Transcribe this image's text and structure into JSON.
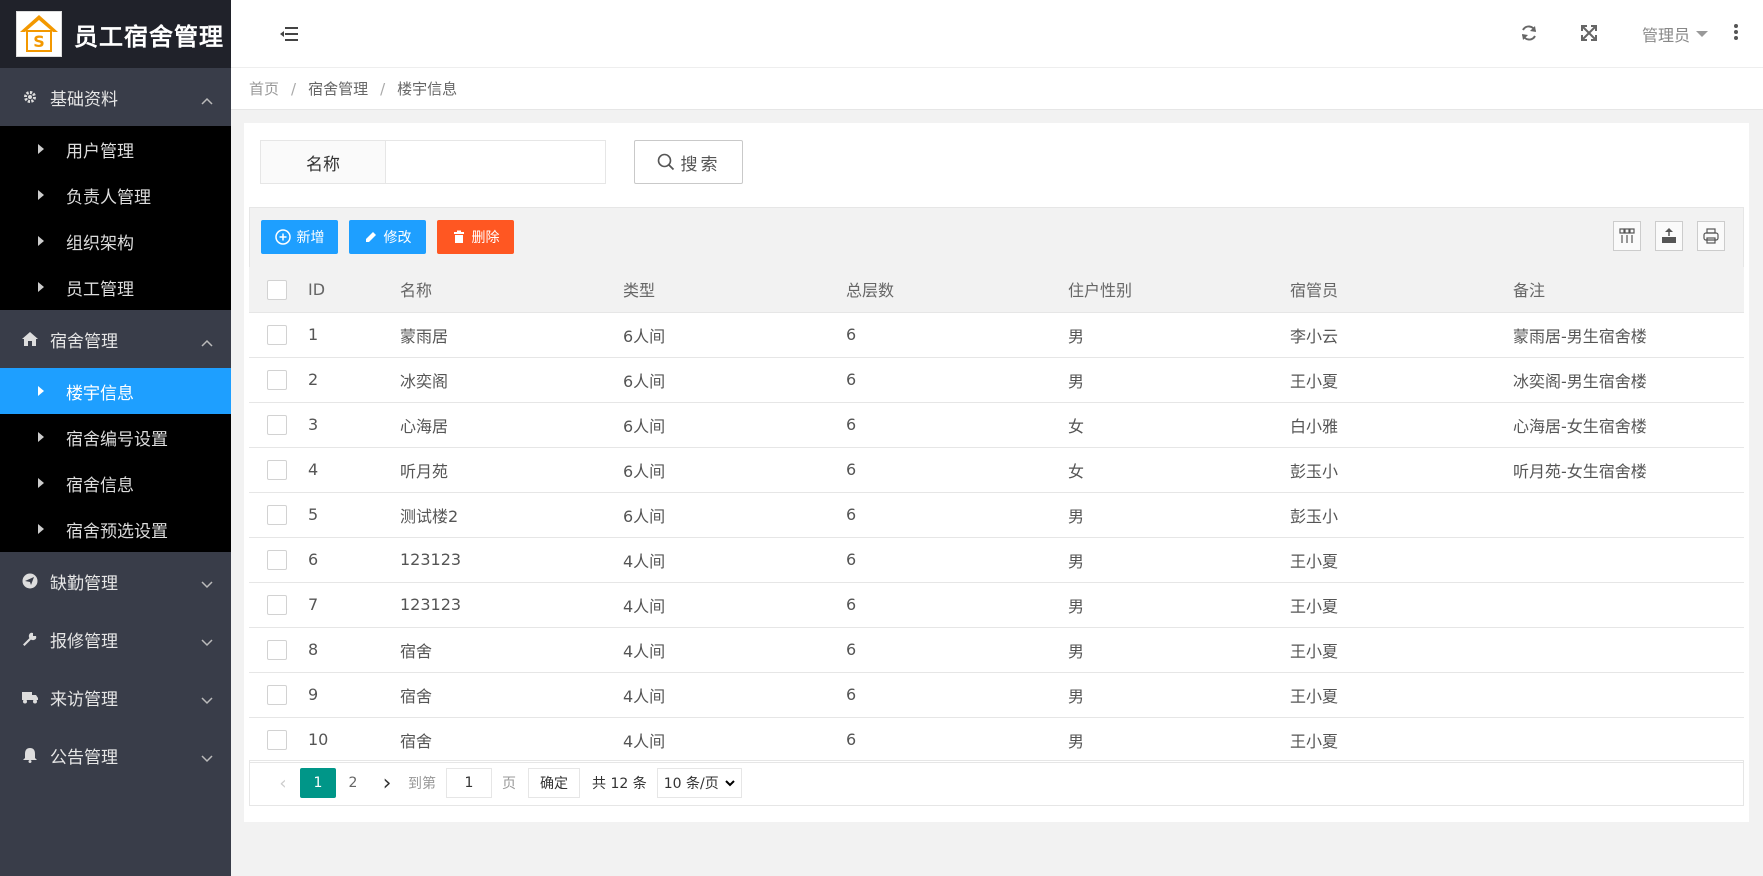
{
  "app": {
    "title": "员工宿舍管理",
    "logo_letter": "S"
  },
  "sidebar": {
    "groups": [
      {
        "label": "基础资料",
        "icon": "gear-icon",
        "expanded": true,
        "items": [
          "用户管理",
          "负责人管理",
          "组织架构",
          "员工管理"
        ]
      },
      {
        "label": "宿舍管理",
        "icon": "home-icon",
        "expanded": true,
        "items": [
          "楼宇信息",
          "宿舍编号设置",
          "宿舍信息",
          "宿舍预选设置"
        ]
      },
      {
        "label": "缺勤管理",
        "icon": "send-icon",
        "expanded": false,
        "items": []
      },
      {
        "label": "报修管理",
        "icon": "wrench-icon",
        "expanded": false,
        "items": []
      },
      {
        "label": "来访管理",
        "icon": "truck-icon",
        "expanded": false,
        "items": []
      },
      {
        "label": "公告管理",
        "icon": "bell-icon",
        "expanded": false,
        "items": []
      }
    ],
    "active_item": "楼宇信息"
  },
  "topbar": {
    "user": "管理员",
    "icons": [
      "menu-toggle-icon",
      "refresh-icon",
      "fullscreen-icon",
      "more-vertical-icon"
    ]
  },
  "breadcrumb": [
    "首页",
    "宿舍管理",
    "楼宇信息"
  ],
  "search": {
    "label": "名称",
    "value": "",
    "button": "搜索"
  },
  "toolbar": {
    "add": "新增",
    "edit": "修改",
    "delete": "删除",
    "colors": {
      "add": "#1e9fff",
      "edit": "#1e9fff",
      "delete": "#ff5722"
    }
  },
  "table": {
    "columns": [
      "ID",
      "名称",
      "类型",
      "总层数",
      "住户性别",
      "宿管员",
      "备注"
    ],
    "rows": [
      [
        "1",
        "蒙雨居",
        "6人间",
        "6",
        "男",
        "李小云",
        "蒙雨居-男生宿舍楼"
      ],
      [
        "2",
        "冰奕阁",
        "6人间",
        "6",
        "男",
        "王小夏",
        "冰奕阁-男生宿舍楼"
      ],
      [
        "3",
        "心海居",
        "6人间",
        "6",
        "女",
        "白小雅",
        "心海居-女生宿舍楼"
      ],
      [
        "4",
        "听月苑",
        "6人间",
        "6",
        "女",
        "彭玉小",
        "听月苑-女生宿舍楼"
      ],
      [
        "5",
        "测试楼2",
        "6人间",
        "6",
        "男",
        "彭玉小",
        ""
      ],
      [
        "6",
        "123123",
        "4人间",
        "6",
        "男",
        "王小夏",
        ""
      ],
      [
        "7",
        "123123",
        "4人间",
        "6",
        "男",
        "王小夏",
        ""
      ],
      [
        "8",
        "宿舍",
        "4人间",
        "6",
        "男",
        "王小夏",
        ""
      ],
      [
        "9",
        "宿舍",
        "4人间",
        "6",
        "男",
        "王小夏",
        ""
      ],
      [
        "10",
        "宿舍",
        "4人间",
        "6",
        "男",
        "王小夏",
        ""
      ]
    ]
  },
  "pager": {
    "current": "1",
    "next": "2",
    "goto_label": "到第",
    "goto_value": "1",
    "page_unit": "页",
    "confirm": "确定",
    "total": "共 12 条",
    "page_size": "10 条/页"
  }
}
